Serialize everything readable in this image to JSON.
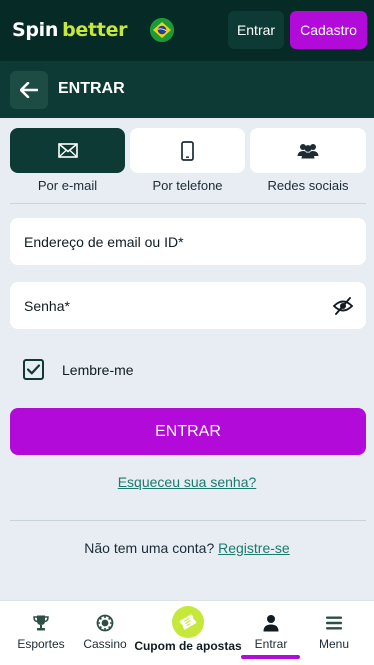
{
  "header": {
    "logo_spin": "Spin",
    "logo_better": "better",
    "flag_icon": "brazil-flag-icon",
    "login_label": "Entrar",
    "register_label": "Cadastro"
  },
  "subheader": {
    "back_icon": "arrow-left-icon",
    "title": "ENTRAR"
  },
  "tabs": [
    {
      "label": "Por e-mail",
      "icon": "envelope-icon",
      "active": true
    },
    {
      "label": "Por telefone",
      "icon": "smartphone-icon",
      "active": false
    },
    {
      "label": "Redes sociais",
      "icon": "users-icon",
      "active": false
    }
  ],
  "form": {
    "email_placeholder": "Endereço de email ou ID*",
    "password_placeholder": "Senha*",
    "remember_label": "Lembre-me",
    "remember_checked": true,
    "submit_label": "ENTRAR",
    "forgot_label": "Esqueceu sua senha?",
    "no_account_text": "Não tem uma conta?",
    "register_link": "Registre-se"
  },
  "bottom_nav": [
    {
      "label": "Esportes",
      "icon": "trophy-icon"
    },
    {
      "label": "Cassino",
      "icon": "casino-chip-icon"
    },
    {
      "label": "Cupom de apostas",
      "icon": "ticket-icon"
    },
    {
      "label": "Entrar",
      "icon": "user-icon",
      "active": true
    },
    {
      "label": "Menu",
      "icon": "hamburger-menu-icon"
    }
  ],
  "colors": {
    "header_bg": "#062a25",
    "subheader_bg": "#0d3a34",
    "accent_purple": "#b20bd9",
    "accent_lime": "#c6e83a",
    "link_teal": "#1a7a6e",
    "page_bg": "#e7edf3"
  }
}
